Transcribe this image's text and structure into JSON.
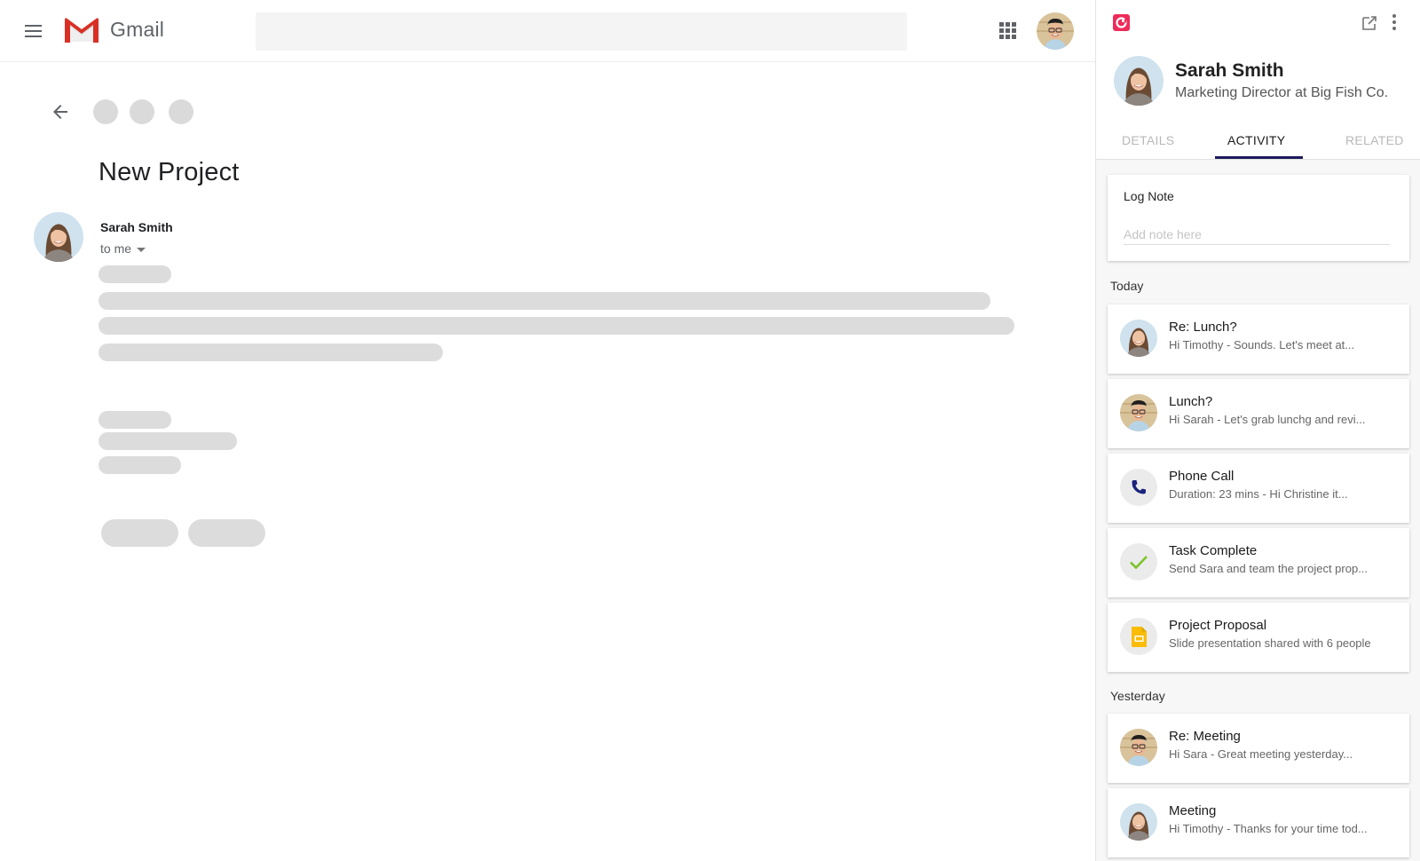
{
  "gmail": {
    "app_name": "Gmail",
    "search": {
      "placeholder": ""
    },
    "email": {
      "subject": "New Project",
      "sender": "Sarah Smith",
      "recipient_label": "to me"
    }
  },
  "panel": {
    "contact": {
      "name": "Sarah Smith",
      "title": "Marketing Director at Big Fish Co."
    },
    "tabs": [
      {
        "label": "DETAILS",
        "active": false
      },
      {
        "label": "ACTIVITY",
        "active": true
      },
      {
        "label": "RELATED",
        "active": false
      }
    ],
    "log_note": {
      "title": "Log Note",
      "placeholder": "Add note here",
      "value": ""
    },
    "sections": [
      {
        "label": "Today",
        "items": [
          {
            "icon": "avatar-sarah",
            "title": "Re: Lunch?",
            "subtitle": "Hi Timothy -  Sounds. Let's meet at..."
          },
          {
            "icon": "avatar-timothy",
            "title": "Lunch?",
            "subtitle": "Hi Sarah - Let's grab lunchg and revi..."
          },
          {
            "icon": "phone-icon",
            "title": "Phone Call",
            "subtitle": "Duration: 23 mins -  Hi Christine it..."
          },
          {
            "icon": "check-icon",
            "title": "Task Complete",
            "subtitle": "Send Sara and team the project prop..."
          },
          {
            "icon": "slides-icon",
            "title": "Project Proposal",
            "subtitle": "Slide presentation shared with 6 people"
          }
        ]
      },
      {
        "label": "Yesterday",
        "items": [
          {
            "icon": "avatar-timothy",
            "title": "Re: Meeting",
            "subtitle": "Hi Sara - Great meeting yesterday..."
          },
          {
            "icon": "avatar-sarah",
            "title": "Meeting",
            "subtitle": "Hi Timothy - Thanks for your time tod..."
          }
        ]
      }
    ]
  },
  "colors": {
    "brand": "#ee2b5a",
    "tab_indicator": "#1d1c5c",
    "phone_icon": "#1a237e",
    "check_icon": "#7cc42a",
    "slides_icon": "#fbbc04",
    "skeleton": "#dcdcdc"
  }
}
